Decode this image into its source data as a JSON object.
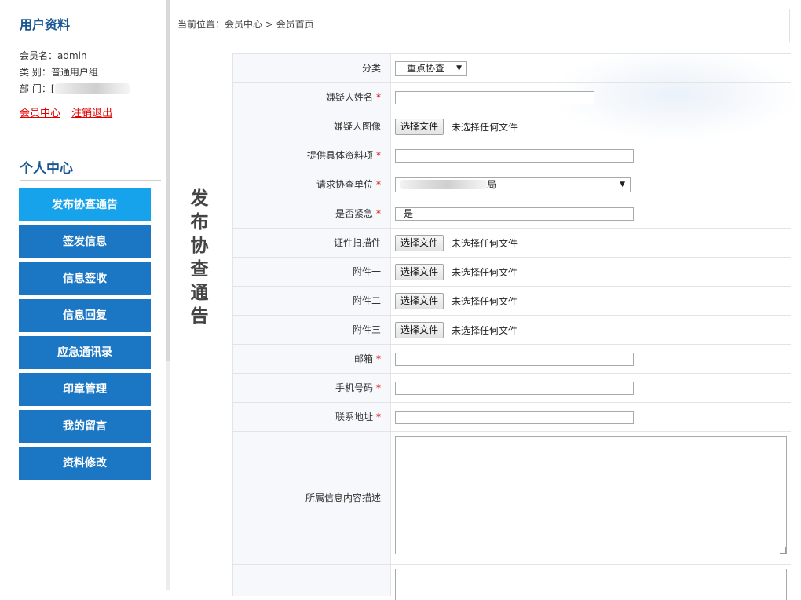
{
  "sidebar": {
    "profile_title": "用户资料",
    "member_label": "会员名：",
    "member_value": "admin",
    "type_label": "类  别：",
    "type_value": "普通用户组",
    "dept_label": "部  门：",
    "dept_value": "[",
    "link_member_center": "会员中心",
    "link_logout": "注销退出",
    "personal_title": "个人中心",
    "menu": [
      {
        "label": "发布协查通告",
        "active": true
      },
      {
        "label": "签发信息"
      },
      {
        "label": "信息签收"
      },
      {
        "label": "信息回复"
      },
      {
        "label": "应急通讯录"
      },
      {
        "label": "印章管理"
      },
      {
        "label": "我的留言"
      },
      {
        "label": "资料修改"
      }
    ]
  },
  "breadcrumb": {
    "prefix": "当前位置：",
    "level1": "会员中心",
    "sep": " > ",
    "level2": "会员首页"
  },
  "page_title": "发布协查通告",
  "form": {
    "category": {
      "label": "分类",
      "value": "重点协查"
    },
    "suspect_name": {
      "label": "嫌疑人姓名",
      "value": ""
    },
    "suspect_image": {
      "label": "嫌疑人图像",
      "button": "选择文件",
      "status": "未选择任何文件"
    },
    "specific_items": {
      "label": "提供具体资料项",
      "value": ""
    },
    "request_unit": {
      "label": "请求协查单位",
      "value": "局"
    },
    "urgent": {
      "label": "是否紧急",
      "value": "是"
    },
    "id_scan": {
      "label": "证件扫描件",
      "button": "选择文件",
      "status": "未选择任何文件"
    },
    "attachment1": {
      "label": "附件一",
      "button": "选择文件",
      "status": "未选择任何文件"
    },
    "attachment2": {
      "label": "附件二",
      "button": "选择文件",
      "status": "未选择任何文件"
    },
    "attachment3": {
      "label": "附件三",
      "button": "选择文件",
      "status": "未选择任何文件"
    },
    "email": {
      "label": "邮箱",
      "value": ""
    },
    "phone": {
      "label": "手机号码",
      "value": ""
    },
    "address": {
      "label": "联系地址",
      "value": ""
    },
    "description": {
      "label": "所属信息内容描述",
      "value": ""
    },
    "required_mark": "*"
  },
  "colors": {
    "menu_bg": "#1b76c4",
    "menu_active_bg": "#17a3ec",
    "title_blue": "#1a5692",
    "required_red": "#e00000"
  }
}
